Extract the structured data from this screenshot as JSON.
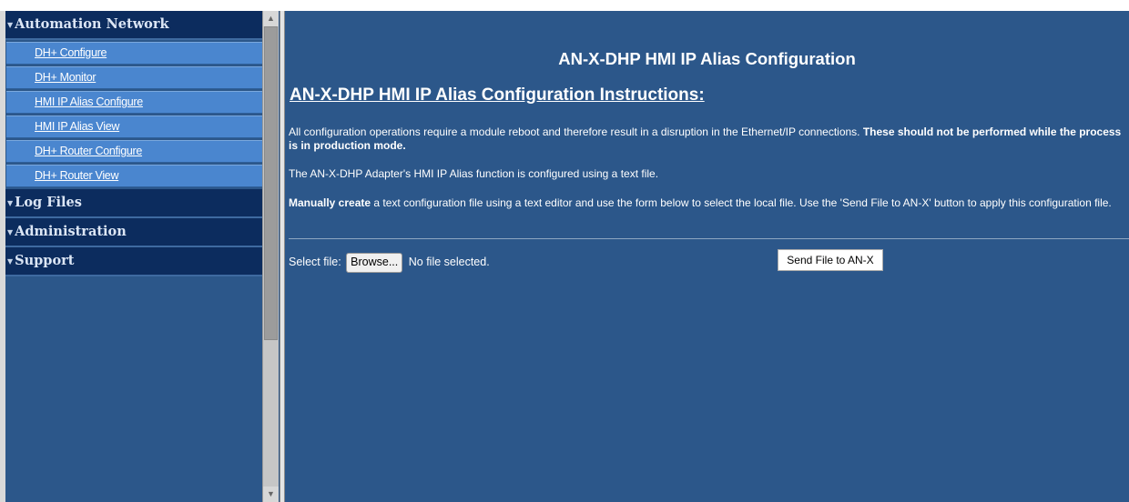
{
  "sidebar": {
    "sections": [
      {
        "title": "Automation Network",
        "items": [
          "DH+ Configure",
          "DH+ Monitor",
          "HMI IP Alias Configure",
          "HMI IP Alias View",
          "DH+ Router Configure",
          "DH+ Router View"
        ]
      },
      {
        "title": "Log Files"
      },
      {
        "title": "Administration"
      },
      {
        "title": "Support"
      }
    ]
  },
  "main": {
    "page_title": "AN-X-DHP HMI IP Alias Configuration",
    "instructions_title": "AN-X-DHP HMI IP Alias Configuration Instructions:",
    "para1_normal": "All configuration operations require a module reboot and therefore result in a disruption in the Ethernet/IP connections. ",
    "para1_bold": "These should not be performed while the process is in production mode.",
    "para2": "The AN-X-DHP Adapter's HMI IP Alias function is configured using a text file.",
    "para3_bold": "Manually create",
    "para3_normal": " a text configuration file using a text editor and use the form below to select the local file. Use the 'Send File to AN-X' button to apply this configuration file.",
    "select_file_label": "Select file:",
    "browse_label": "Browse...",
    "no_file_text": "No file selected.",
    "send_button_label": "Send File to AN-X"
  }
}
